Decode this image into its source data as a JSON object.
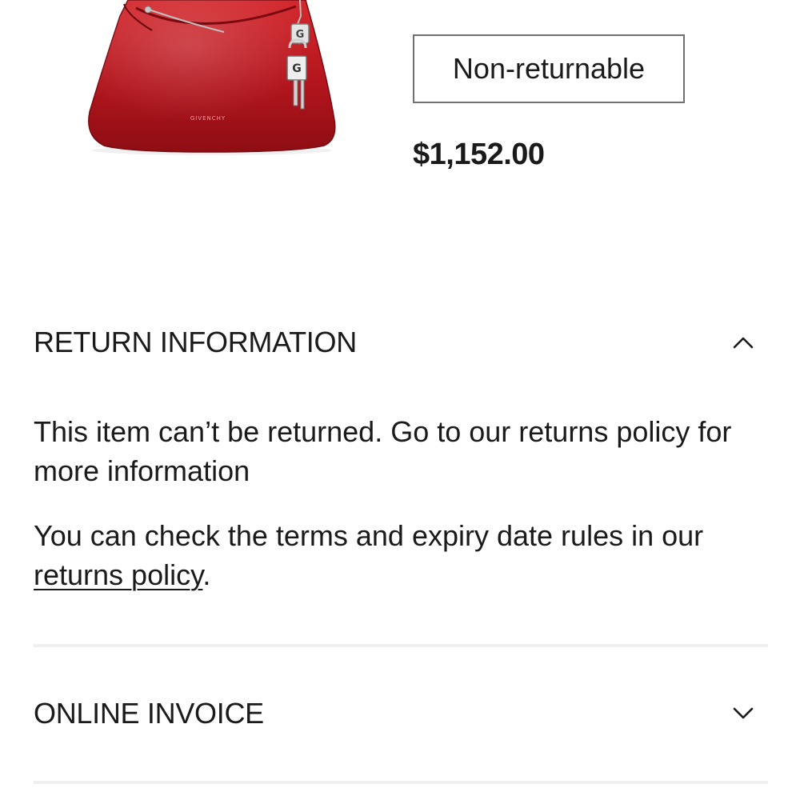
{
  "product": {
    "image_alt": "Red patent leather shoulder bag with silver padlock charm",
    "brand_text_on_bag": "GIVENCHY",
    "status_label": "Non-returnable",
    "price": "$1,152.00"
  },
  "return_section": {
    "title": "RETURN INFORMATION",
    "expanded": true,
    "paragraph_1": "This item can’t be returned. Go to our returns policy for more information",
    "paragraph_2_prefix": "You can check the terms and expiry date rules in our ",
    "paragraph_2_link": "returns policy",
    "paragraph_2_suffix": "."
  },
  "invoice_section": {
    "title": "ONLINE INVOICE",
    "expanded": false
  },
  "colors": {
    "text": "#1a1a1a",
    "border": "#707070",
    "divider": "#efefef",
    "bag_red": "#b0141c"
  },
  "icons": {
    "return_chevron": "chevron-up-icon",
    "invoice_chevron": "chevron-down-icon"
  }
}
